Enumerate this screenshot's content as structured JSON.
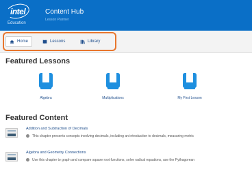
{
  "header": {
    "logo_text": "intel",
    "logo_sub": "Education",
    "app_title": "Content Hub",
    "app_subtitle": "Lesson Planner",
    "bg_color": "#0a6fc7"
  },
  "nav": {
    "highlight_color": "#e8762d",
    "tabs": [
      {
        "label": "Home",
        "icon": "home-icon",
        "active": true
      },
      {
        "label": "Lessons",
        "icon": "book-icon",
        "active": false
      },
      {
        "label": "Library",
        "icon": "library-icon",
        "active": false
      }
    ]
  },
  "featured_lessons": {
    "title": "Featured Lessons",
    "items": [
      {
        "label": "Algebra",
        "icon": "book-icon"
      },
      {
        "label": "Multiplications",
        "icon": "book-icon"
      },
      {
        "label": "My First Lesson",
        "icon": "book-icon"
      }
    ],
    "icon_color": "#1e8fdf"
  },
  "featured_content": {
    "title": "Featured Content",
    "items": [
      {
        "title": "Addition and Subtraction of Decimals",
        "description": "This chapter presents concepts involving decimals, including an introduction to decimals, measuring metric"
      },
      {
        "title": "Algebra and Geometry Connections",
        "description": "Use this chapter to graph and compare square root functions, solve radical equations, use the Pythagorean"
      }
    ]
  }
}
